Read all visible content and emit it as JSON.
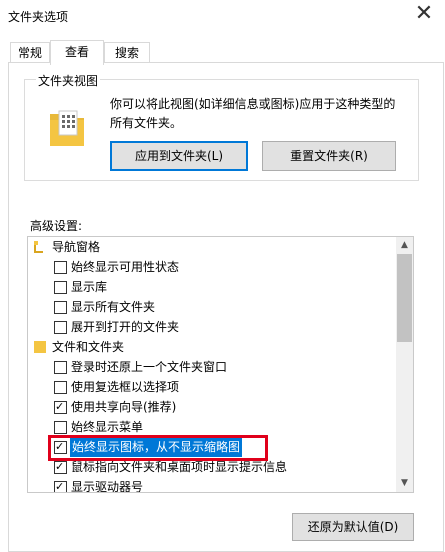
{
  "window": {
    "title": "文件夹选项",
    "close_glyph": "✕"
  },
  "tabs": [
    {
      "label": "常规",
      "active": false
    },
    {
      "label": "查看",
      "active": true
    },
    {
      "label": "搜索",
      "active": false
    }
  ],
  "folder_views": {
    "group_label": "文件夹视图",
    "description": "你可以将此视图(如详细信息或图标)应用于这种类型的所有文件夹。",
    "apply_button": "应用到文件夹(L)",
    "reset_button": "重置文件夹(R)"
  },
  "advanced": {
    "label": "高级设置:",
    "items": [
      {
        "type": "group",
        "label": "导航窗格",
        "icon": "navigation-pane-icon"
      },
      {
        "type": "checkbox",
        "label": "始终显示可用性状态",
        "checked": false
      },
      {
        "type": "checkbox",
        "label": "显示库",
        "checked": false
      },
      {
        "type": "checkbox",
        "label": "显示所有文件夹",
        "checked": false
      },
      {
        "type": "checkbox",
        "label": "展开到打开的文件夹",
        "checked": false
      },
      {
        "type": "group",
        "label": "文件和文件夹",
        "icon": "folder-icon"
      },
      {
        "type": "checkbox",
        "label": "登录时还原上一个文件夹窗口",
        "checked": false
      },
      {
        "type": "checkbox",
        "label": "使用复选框以选择项",
        "checked": false
      },
      {
        "type": "checkbox",
        "label": "使用共享向导(推荐)",
        "checked": true
      },
      {
        "type": "checkbox",
        "label": "始终显示菜单",
        "checked": false
      },
      {
        "type": "checkbox",
        "label": "始终显示图标，从不显示缩略图",
        "checked": true,
        "selected": true
      },
      {
        "type": "checkbox",
        "label": "鼠标指向文件夹和桌面项时显示提示信息",
        "checked": true
      },
      {
        "type": "checkbox",
        "label": "显示驱动器号",
        "checked": true
      }
    ],
    "restore_button": "还原为默认值(D)"
  },
  "colors": {
    "selection": "#0078d7",
    "annotation": "#e0001b",
    "folder": "#f4c542"
  }
}
